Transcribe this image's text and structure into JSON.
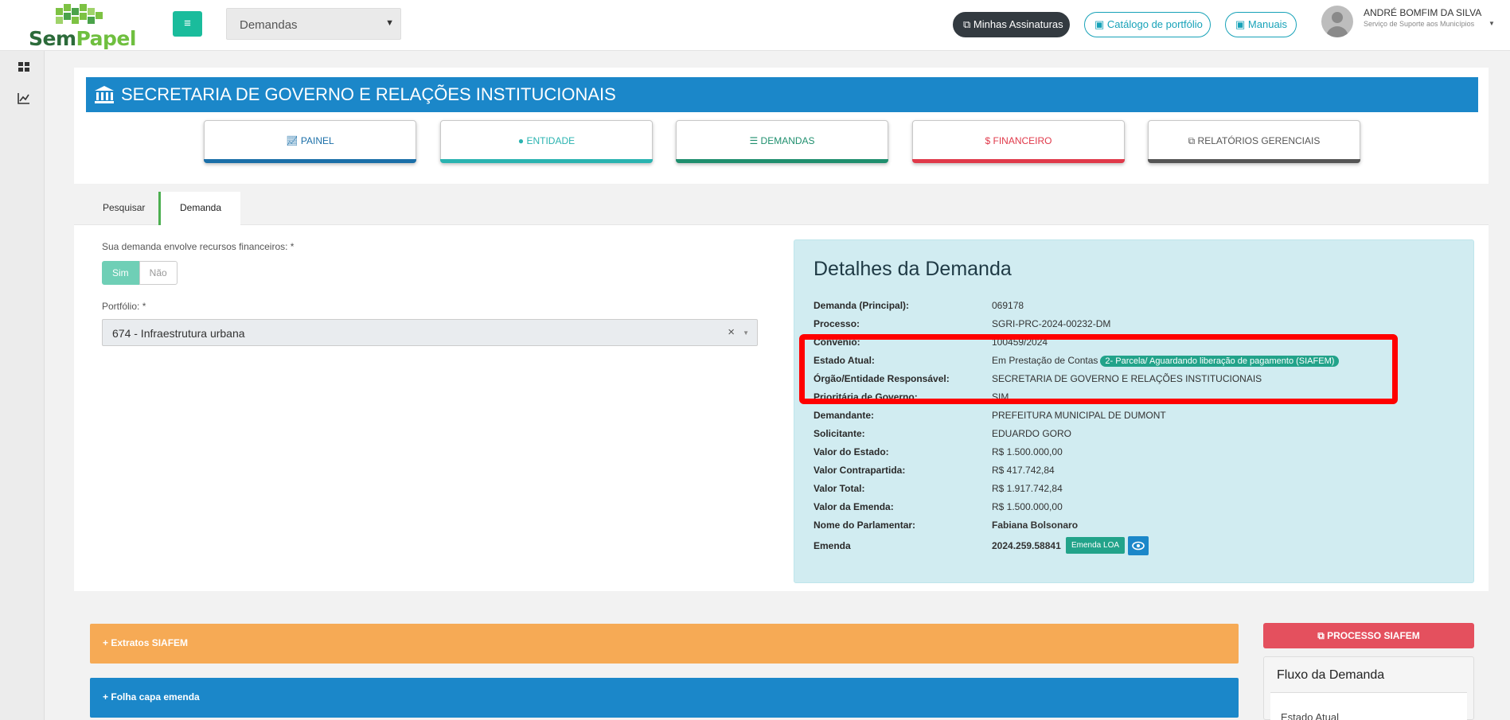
{
  "header": {
    "logo_text_a": "Sem",
    "logo_text_b": "Papel",
    "module_select": "Demandas",
    "btn_assinaturas": "Minhas Assinaturas",
    "btn_catalogo": "Catálogo de portfólio",
    "btn_manuais": "Manuais",
    "user_name": "ANDRÉ BOMFIM DA SILVA",
    "user_role": "Serviço de Suporte aos Municípios"
  },
  "banner": {
    "title": "SECRETARIA DE GOVERNO E RELAÇÕES INSTITUCIONAIS"
  },
  "nav": [
    {
      "label": "PAINEL",
      "color": "#1b6fa8",
      "icon": "chart-line-icon"
    },
    {
      "label": "ENTIDADE",
      "color": "#2ab3b0",
      "icon": "user-icon"
    },
    {
      "label": "DEMANDAS",
      "color": "#1f8f6e",
      "icon": "list-icon"
    },
    {
      "label": "$ FINANCEIRO",
      "color": "#e0394a",
      "icon": ""
    },
    {
      "label": "RELATÓRIOS GERENCIAIS",
      "color": "#555555",
      "icon": "copy-icon"
    }
  ],
  "tabs": {
    "pesquisar": "Pesquisar",
    "demanda": "Demanda"
  },
  "form": {
    "q_recursos": "Sua demanda envolve recursos financeiros: *",
    "sim": "Sim",
    "nao": "Não",
    "portfolio_label": "Portfólio: *",
    "portfolio_value": "674 - Infraestrutura urbana"
  },
  "details": {
    "title": "Detalhes da Demanda",
    "rows": [
      {
        "label": "Demanda (Principal):",
        "value": "069178"
      },
      {
        "label": "Processo:",
        "value": "SGRI-PRC-2024-00232-DM"
      },
      {
        "label": "Convênio:",
        "value": "100459/2024"
      },
      {
        "label": "Estado Atual:",
        "value": "Em Prestação de Contas",
        "badge": "2- Parcela/ Aguardando liberação de pagamento (SIAFEM)"
      },
      {
        "label": "Órgão/Entidade Responsável:",
        "value": "SECRETARIA DE GOVERNO E RELAÇÕES INSTITUCIONAIS"
      },
      {
        "label": "Prioritária de Governo:",
        "value": "SIM"
      },
      {
        "label": "Demandante:",
        "value": "PREFEITURA MUNICIPAL DE DUMONT"
      },
      {
        "label": "Solicitante:",
        "value": "EDUARDO GORO"
      },
      {
        "label": "Valor do Estado:",
        "value": "R$ 1.500.000,00"
      },
      {
        "label": "Valor Contrapartida:",
        "value": "R$ 417.742,84"
      },
      {
        "label": "Valor Total:",
        "value": "R$ 1.917.742,84"
      },
      {
        "label": "Valor da Emenda:",
        "value": "R$ 1.500.000,00"
      },
      {
        "label": "Nome do Parlamentar:",
        "value": "Fabiana Bolsonaro"
      },
      {
        "label": "Emenda",
        "value": "2024.259.58841",
        "badge": "Emenda LOA"
      }
    ]
  },
  "bottom": {
    "extratos": "Extratos SIAFEM",
    "folha": "Folha capa emenda",
    "processo_siafem": "PROCESSO SIAFEM",
    "fluxo_title": "Fluxo da Demanda",
    "estado_atual": "Estado Atual"
  },
  "colors": {
    "primary": "#1b87c9",
    "teal": "#1abc9c",
    "highlight": "#ff0000",
    "danger": "#e4505e",
    "warning": "#f6aa55"
  }
}
